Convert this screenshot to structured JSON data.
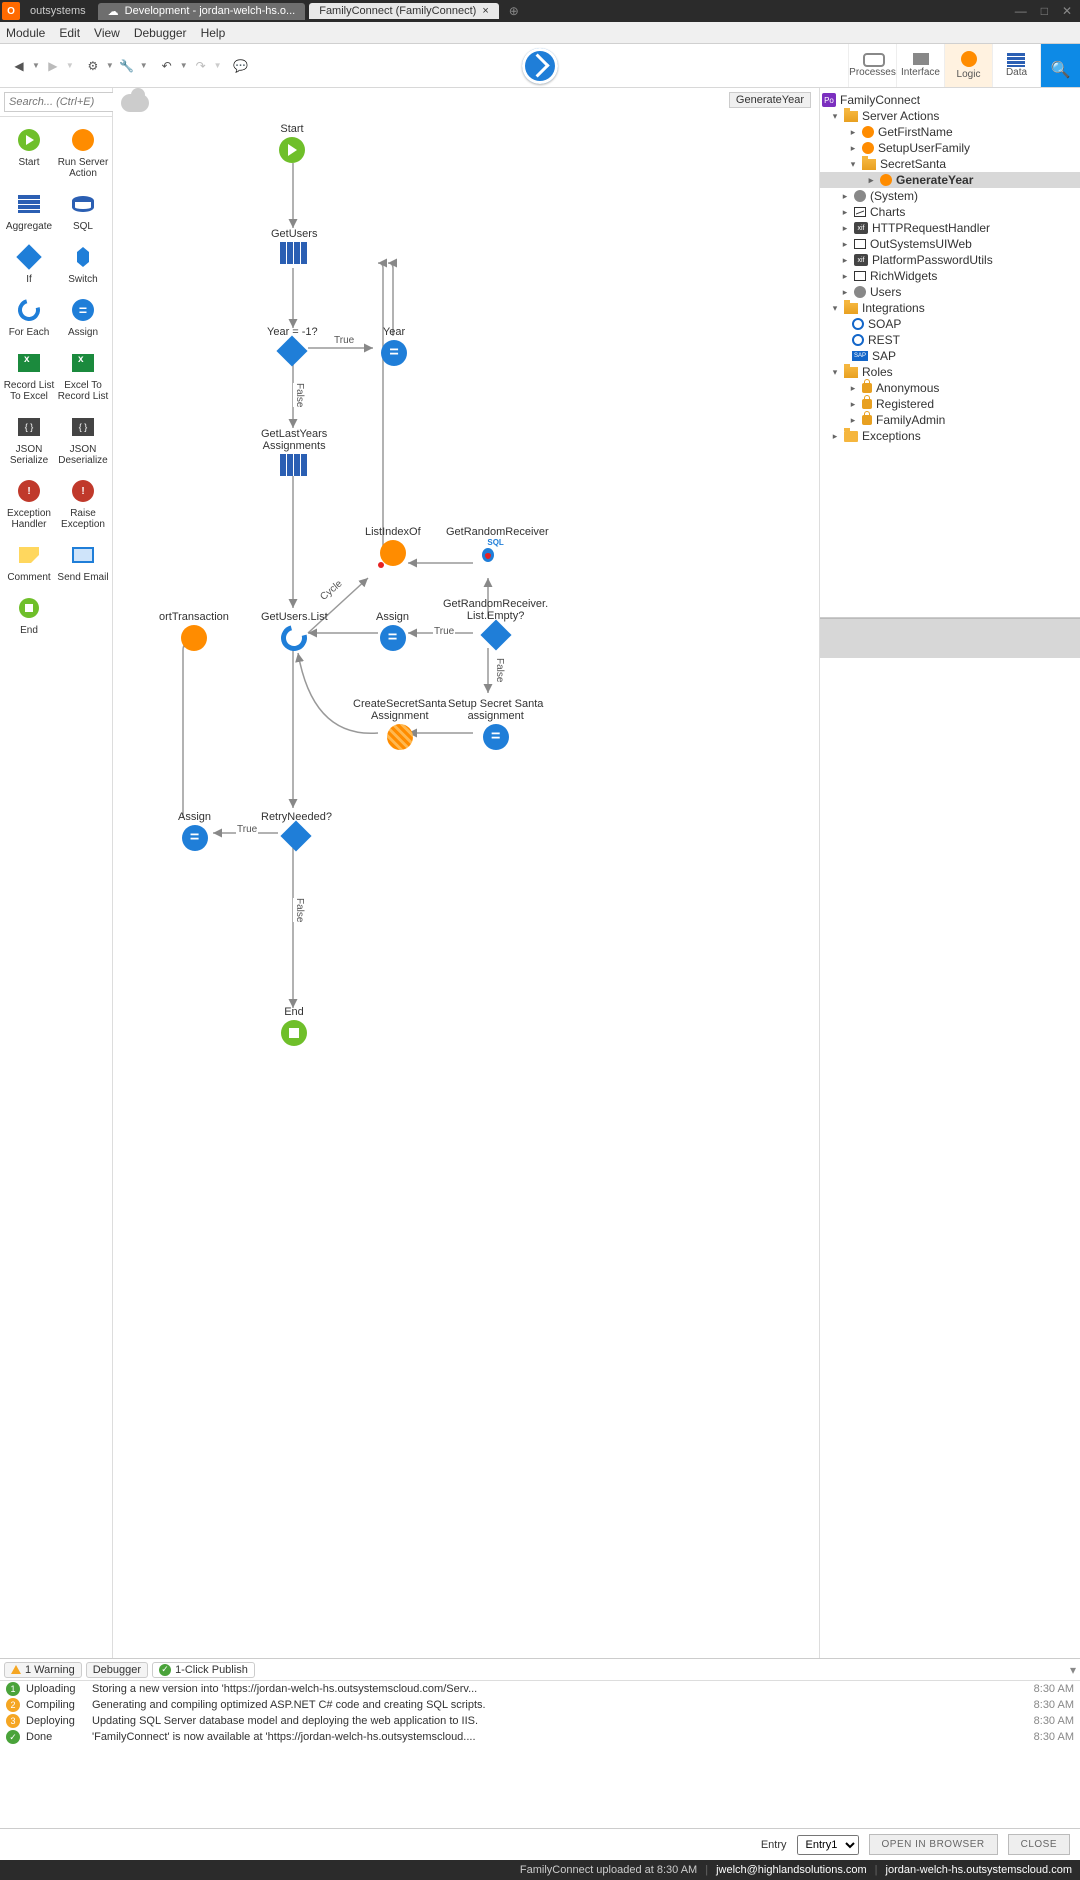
{
  "titlebar": {
    "brand": "outsystems",
    "tab1": "Development - jordan-welch-hs.o...",
    "tab2": "FamilyConnect (FamilyConnect)"
  },
  "menu": {
    "module": "Module",
    "edit": "Edit",
    "view": "View",
    "debugger": "Debugger",
    "help": "Help"
  },
  "righticons": {
    "processes": "Processes",
    "interface": "Interface",
    "logic": "Logic",
    "data": "Data"
  },
  "search": {
    "placeholder": "Search... (Ctrl+E)"
  },
  "toolbox": {
    "start": "Start",
    "runserver": "Run Server Action",
    "aggregate": "Aggregate",
    "sql": "SQL",
    "if": "If",
    "switch": "Switch",
    "foreach": "For Each",
    "assign": "Assign",
    "rltoexcel": "Record List To Excel",
    "exceltorl": "Excel To Record List",
    "jsonser": "JSON Serialize",
    "jsondes": "JSON Deserialize",
    "exchandler": "Exception Handler",
    "raiseexc": "Raise Exception",
    "comment": "Comment",
    "sendemail": "Send Email",
    "end": "End"
  },
  "canvas": {
    "title": "GenerateYear",
    "nodes": {
      "start": "Start",
      "getusers": "GetUsers",
      "yearq": "Year = -1?",
      "year": "Year",
      "getlast": "GetLastYears\nAssignments",
      "listindex": "ListIndexOf",
      "getrandom": "GetRandomReceiver",
      "orttrans": "ortTransaction",
      "getuserslist": "GetUsers.List",
      "assign": "Assign",
      "emptyq": "GetRandomReceiver.\nList.Empty?",
      "createss": "CreateSecretSanta\nAssignment",
      "setupss": "Setup Secret Santa\nassignment",
      "assign2": "Assign",
      "retry": "RetryNeeded?",
      "end": "End"
    },
    "edges": {
      "true1": "True",
      "false1": "False",
      "cycle": "Cycle",
      "true2": "True",
      "false2": "False",
      "true3": "True"
    }
  },
  "tree": {
    "root": "FamilyConnect",
    "serveractions": "Server Actions",
    "getfirstname": "GetFirstName",
    "setupuserfamily": "SetupUserFamily",
    "secretsanta": "SecretSanta",
    "generateyear": "GenerateYear",
    "system": "(System)",
    "charts": "Charts",
    "httpreq": "HTTPRequestHandler",
    "osuiweb": "OutSystemsUIWeb",
    "ppu": "PlatformPasswordUtils",
    "richwidgets": "RichWidgets",
    "users": "Users",
    "integrations": "Integrations",
    "soap": "SOAP",
    "rest": "REST",
    "sap": "SAP",
    "roles": "Roles",
    "anonymous": "Anonymous",
    "registered": "Registered",
    "familyadmin": "FamilyAdmin",
    "exceptions": "Exceptions"
  },
  "btabs": {
    "warning": "1 Warning",
    "debugger": "Debugger",
    "publish": "1-Click Publish"
  },
  "log": [
    {
      "n": "1",
      "cls": "n1",
      "stage": "Uploading",
      "msg": "Storing a new version into 'https://jordan-welch-hs.outsystemscloud.com/Serv...",
      "time": "8:30 AM"
    },
    {
      "n": "2",
      "cls": "n2",
      "stage": "Compiling",
      "msg": "Generating and compiling optimized ASP.NET C# code and creating SQL scripts.",
      "time": "8:30 AM"
    },
    {
      "n": "3",
      "cls": "n3",
      "stage": "Deploying",
      "msg": "Updating SQL Server database model and deploying the web application to IIS.",
      "time": "8:30 AM"
    },
    {
      "n": "✓",
      "cls": "chk",
      "stage": "Done",
      "msg": "'FamilyConnect' is now available at 'https://jordan-welch-hs.outsystemscloud....",
      "time": "8:30 AM"
    }
  ],
  "entrybar": {
    "label": "Entry",
    "value": "Entry1",
    "open": "OPEN IN BROWSER",
    "close": "CLOSE"
  },
  "status": {
    "msg": "FamilyConnect uploaded at 8:30 AM",
    "user": "jwelch@highlandsolutions.com",
    "env": "jordan-welch-hs.outsystemscloud.com"
  }
}
